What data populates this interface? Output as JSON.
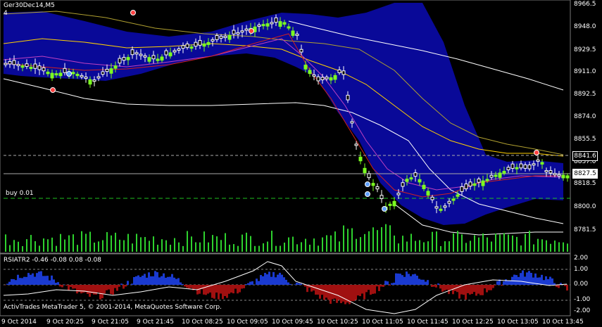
{
  "window": {
    "title": "Ger30Dec14,M5",
    "subtitle": "4"
  },
  "trade_label": "buy 0.01",
  "price_axis": {
    "ticks": [
      "8966.5",
      "8948.0",
      "8929.5",
      "8911.0",
      "8892.5",
      "8874.0",
      "8855.5",
      "8837.0",
      "8818.5",
      "8800.0",
      "8781.5"
    ],
    "box_current": "8827.5",
    "box_level": "8841.6"
  },
  "indicator": {
    "title": "RSIATR2 -0.46 -0.08 0.08 -0.08",
    "ticks": [
      "2.00",
      "1.00",
      "0.00",
      "-1.00",
      "-2.00"
    ]
  },
  "time_axis": {
    "ticks": [
      "9 Oct 2014",
      "9 Oct 20:25",
      "9 Oct 21:05",
      "9 Oct 21:45",
      "10 Oct 08:25",
      "10 Oct 09:05",
      "10 Oct 09:45",
      "10 Oct 10:25",
      "10 Oct 11:05",
      "10 Oct 11:45",
      "10 Oct 12:25",
      "10 Oct 13:05",
      "10 Oct 13:45"
    ]
  },
  "copyright": "ActivTrades MetaTrader 5, © 2001-2014, MetaQuotes Software Corp.",
  "colors": {
    "background": "#000000",
    "band": "#0a0aa0",
    "bull": "#7cff20",
    "bear": "#ffffff",
    "volume": "#2ed12e"
  }
}
